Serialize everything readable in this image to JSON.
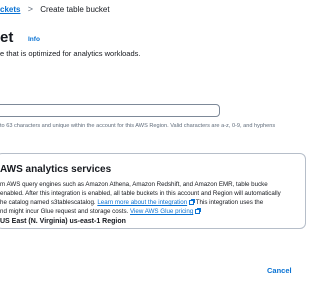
{
  "breadcrumb": {
    "parent": "ckets",
    "separator": ">",
    "current": "Create table bucket"
  },
  "header": {
    "title": "et",
    "info": "Info",
    "subtitle": "e that is optimized for analytics workloads."
  },
  "name_field": {
    "value": "",
    "constraint": "to 63 characters and unique within the account for this AWS Region. Valid characters are a-z, 0-9, and hyphens"
  },
  "integration": {
    "title": "AWS analytics services",
    "line1": "m AWS query engines such as Amazon Athena, Amazon Redshift, and Amazon EMR, table bucke",
    "line2": "enabled. After this integration is enabled, all table buckets in this account and Region will automatically",
    "line3_prefix": "he catalog named s3tablescatalog. ",
    "learn_more": "Learn more about the integration",
    "line3_suffix": " This integration uses the",
    "line4_prefix": "nd might incur Glue request and storage costs. ",
    "glue_link": "View AWS Glue pricing",
    "region": "US East (N. Virginia) us-east-1 Region"
  },
  "footer": {
    "cancel_label": "Cancel"
  },
  "colors": {
    "link": "#0972d3",
    "text": "#16191f",
    "border": "#b6bec9"
  }
}
